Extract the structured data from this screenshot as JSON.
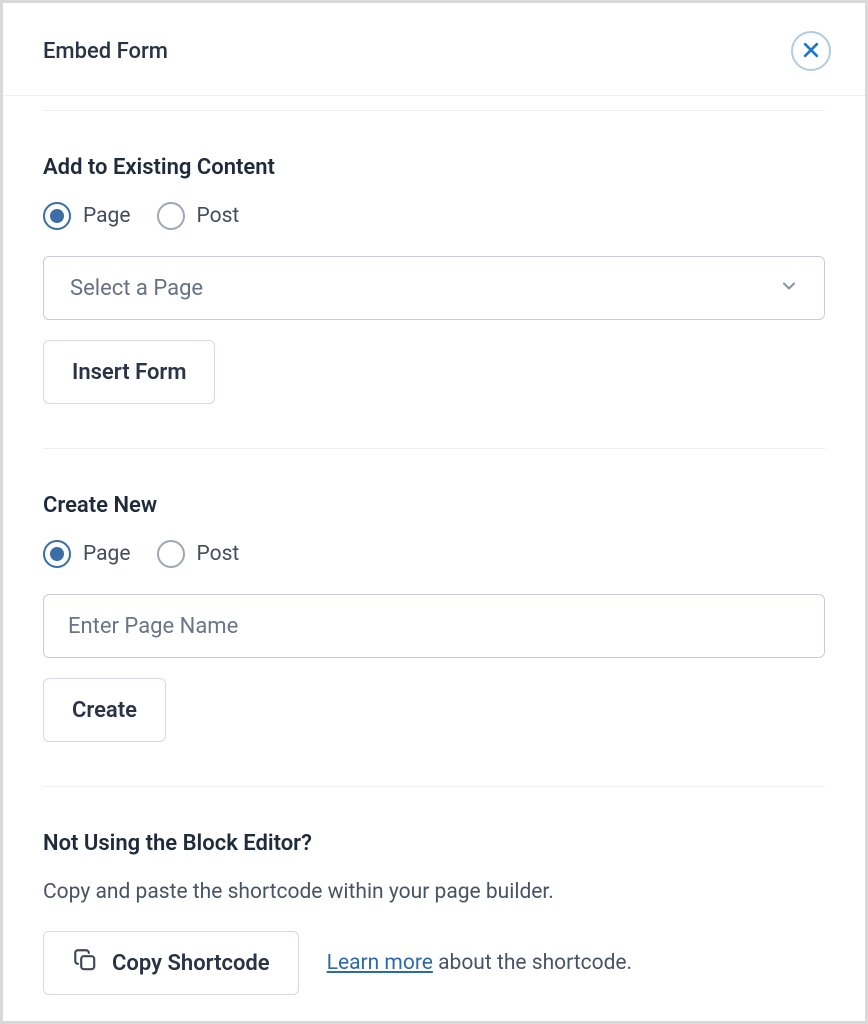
{
  "header": {
    "title": "Embed Form"
  },
  "addExisting": {
    "heading": "Add to Existing Content",
    "options": {
      "page": "Page",
      "post": "Post"
    },
    "selected": "page",
    "selectPlaceholder": "Select a Page",
    "insertButton": "Insert Form"
  },
  "createNew": {
    "heading": "Create New",
    "options": {
      "page": "Page",
      "post": "Post"
    },
    "selected": "page",
    "inputPlaceholder": "Enter Page Name",
    "createButton": "Create"
  },
  "shortcode": {
    "heading": "Not Using the Block Editor?",
    "description": "Copy and paste the shortcode within your page builder.",
    "copyButton": "Copy Shortcode",
    "learnMore": "Learn more",
    "aboutText": " about the shortcode."
  }
}
